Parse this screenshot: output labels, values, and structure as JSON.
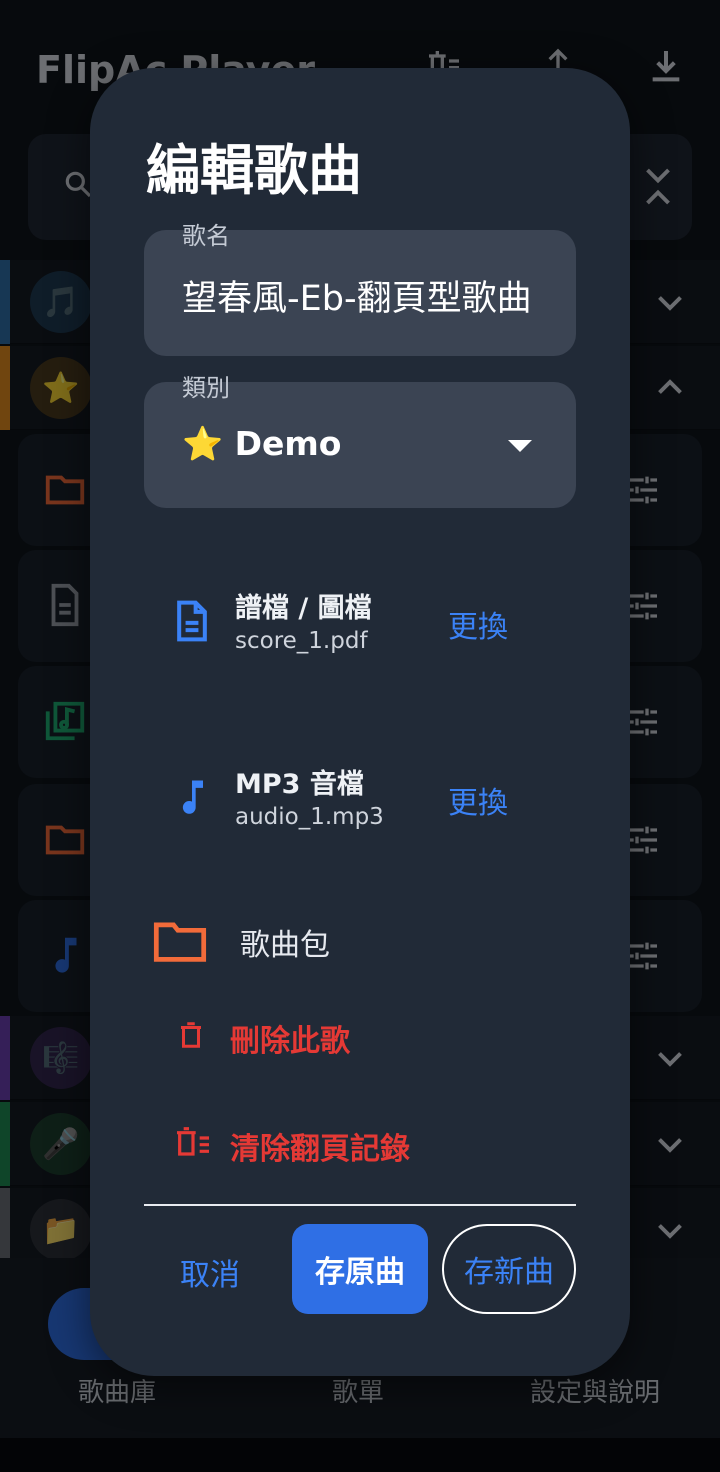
{
  "app": {
    "title": "FlipAc Player"
  },
  "bottom_nav": {
    "items": [
      {
        "label": "歌曲庫"
      },
      {
        "label": "歌單"
      },
      {
        "label": "設定與說明"
      }
    ]
  },
  "background_categories": [
    {
      "emoji": "🎵",
      "color": "#2e6ea8"
    },
    {
      "emoji": "⭐",
      "color": "#e08a1e"
    },
    {
      "emoji": "🎼",
      "color": "#6a3fb0"
    },
    {
      "emoji": "🎤",
      "color": "#1f8a52"
    },
    {
      "emoji": "📁",
      "color": "#6b6f76"
    }
  ],
  "dialog": {
    "title": "編輯歌曲",
    "song_name_label": "歌名",
    "song_name_value": "望春風-Eb-翻頁型歌曲",
    "category_label": "類別",
    "category_value": "⭐ Demo",
    "score": {
      "title": "譜檔 / 圖檔",
      "filename": "score_1.pdf",
      "action": "更換"
    },
    "audio": {
      "title": "MP3 音檔",
      "filename": "audio_1.mp3",
      "action": "更換"
    },
    "package_label": "歌曲包",
    "delete_label": "刪除此歌",
    "clear_label": "清除翻頁記錄",
    "cancel_label": "取消",
    "save_label": "存原曲",
    "save_new_label": "存新曲"
  },
  "colors": {
    "accent": "#3b82f6",
    "primary_button": "#2f6fe5",
    "danger": "#e53935",
    "folder": "#f26b3a",
    "dialog_bg": "#212a37"
  }
}
